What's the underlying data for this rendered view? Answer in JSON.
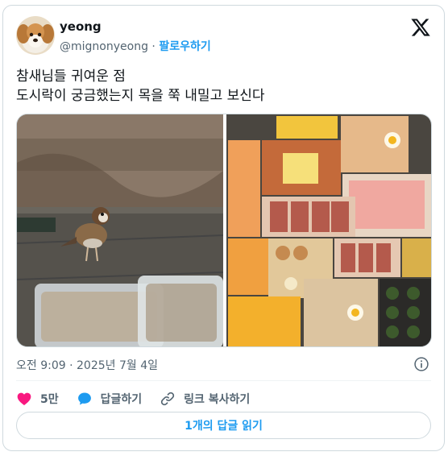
{
  "author": {
    "name": "yeong",
    "handle": "@mignonyeong",
    "separator": "·",
    "follow_label": "팔로우하기"
  },
  "tweet": {
    "lines": [
      "참새님들 귀여운 점",
      "도시락이 궁금했는지 목을 쭉 내밀고 보신다"
    ]
  },
  "meta": {
    "timestamp": "오전 9:09 · 2025년 7월 4일"
  },
  "actions": {
    "like_count": "5만",
    "reply_label": "답글하기",
    "copy_link_label": "링크 복사하기"
  },
  "read_replies_label": "1개의 답글 읽기",
  "colors": {
    "accent": "#1d9bf0",
    "like": "#f91880",
    "muted": "#536471",
    "text": "#0f1419"
  },
  "icons": [
    "x-logo-icon",
    "info-icon",
    "heart-icon",
    "reply-bubble-icon",
    "link-icon"
  ]
}
